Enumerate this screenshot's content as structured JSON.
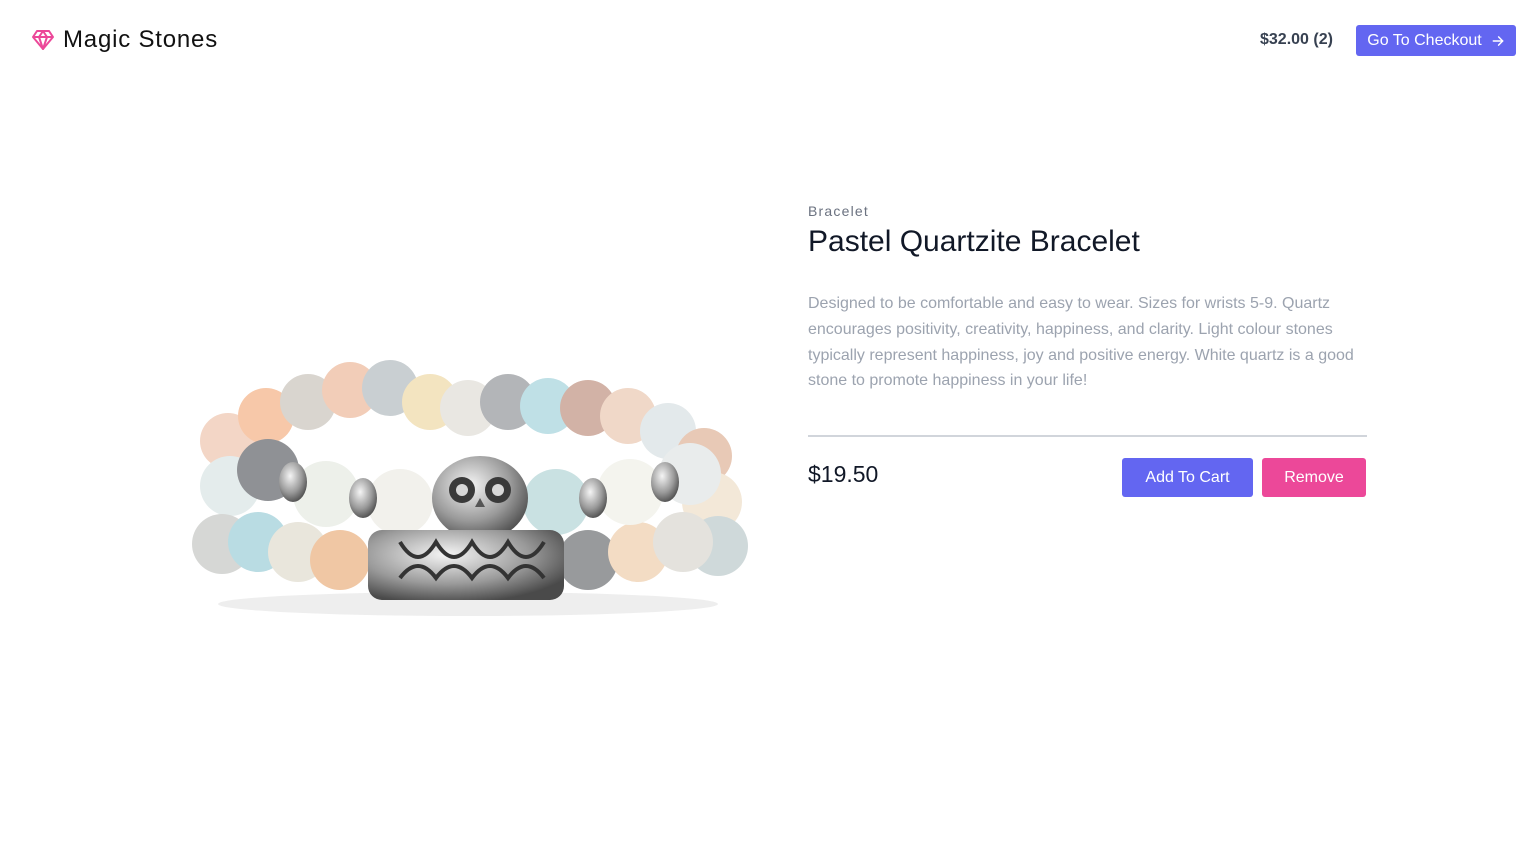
{
  "brand": {
    "name": "Magic Stones",
    "icon": "gem-icon",
    "icon_color": "#ec4899"
  },
  "header": {
    "cart_summary": "$32.00 (2)",
    "checkout_label": "Go To Checkout",
    "checkout_icon": "arrow-right-icon"
  },
  "product": {
    "category": "Bracelet",
    "name": "Pastel Quartzite Bracelet",
    "description": "Designed to be comfortable and easy to wear. Sizes for wrists 5-9. Quartz encourages positivity, creativity, happiness, and clarity. Light colour stones typically represent happiness, joy and positive energy. White quartz is a good stone to promote happiness in your life!",
    "price": "$19.50",
    "image": "owl-bead-bracelet-image"
  },
  "actions": {
    "add_label": "Add To Cart",
    "remove_label": "Remove"
  },
  "colors": {
    "primary": "#6366f1",
    "accent": "#ec4899"
  }
}
